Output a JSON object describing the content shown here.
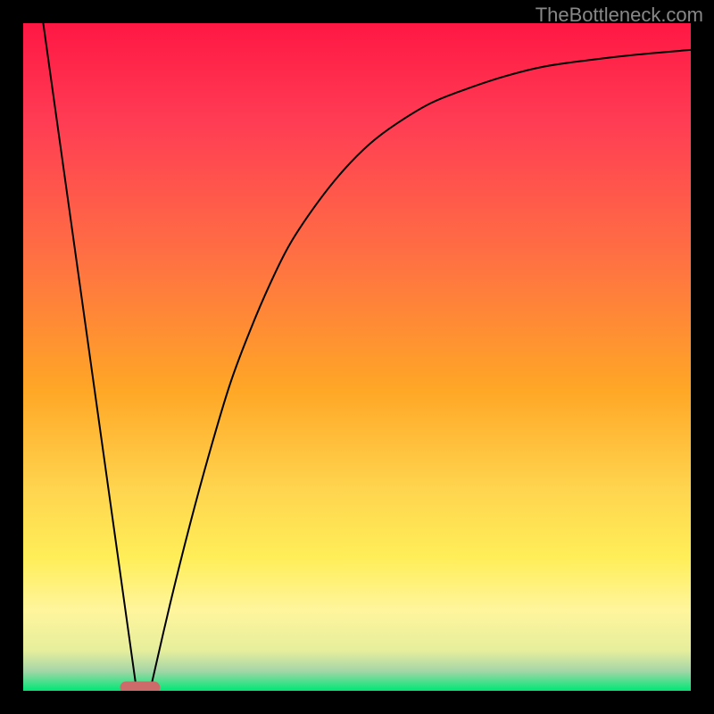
{
  "watermark": "TheBottleneck.com",
  "chart_data": {
    "type": "line",
    "title": "",
    "xlabel": "",
    "ylabel": "",
    "xlim": [
      0,
      100
    ],
    "ylim": [
      0,
      100
    ],
    "background": {
      "type": "vertical_gradient",
      "stops": [
        {
          "pos": 0,
          "color": "#FF1744"
        },
        {
          "pos": 15,
          "color": "#FF3D54"
        },
        {
          "pos": 35,
          "color": "#FF7043"
        },
        {
          "pos": 55,
          "color": "#FFA726"
        },
        {
          "pos": 70,
          "color": "#FFD54F"
        },
        {
          "pos": 80,
          "color": "#FFEE58"
        },
        {
          "pos": 88,
          "color": "#FFF59D"
        },
        {
          "pos": 94,
          "color": "#E6EE9C"
        },
        {
          "pos": 97,
          "color": "#A5D6A7"
        },
        {
          "pos": 100,
          "color": "#00E676"
        }
      ]
    },
    "marker": {
      "x": 17.5,
      "y": 0.5,
      "width": 6,
      "height": 1.8,
      "color": "#CD6B6B",
      "shape": "rounded_rect"
    },
    "series": [
      {
        "name": "curve",
        "color": "#000000",
        "stroke_width": 2,
        "type": "path",
        "segments": [
          {
            "kind": "line",
            "points": [
              {
                "x": 3,
                "y": 100
              },
              {
                "x": 17,
                "y": 0
              }
            ]
          },
          {
            "kind": "curve",
            "points": [
              {
                "x": 19,
                "y": 0
              },
              {
                "x": 22,
                "y": 13
              },
              {
                "x": 25,
                "y": 25
              },
              {
                "x": 28,
                "y": 36
              },
              {
                "x": 31,
                "y": 46
              },
              {
                "x": 34,
                "y": 54
              },
              {
                "x": 37,
                "y": 61
              },
              {
                "x": 40,
                "y": 67
              },
              {
                "x": 44,
                "y": 73
              },
              {
                "x": 48,
                "y": 78
              },
              {
                "x": 52,
                "y": 82
              },
              {
                "x": 56,
                "y": 85
              },
              {
                "x": 61,
                "y": 88
              },
              {
                "x": 66,
                "y": 90
              },
              {
                "x": 72,
                "y": 92
              },
              {
                "x": 78,
                "y": 93.5
              },
              {
                "x": 85,
                "y": 94.5
              },
              {
                "x": 92,
                "y": 95.3
              },
              {
                "x": 100,
                "y": 96
              }
            ]
          }
        ]
      }
    ]
  }
}
